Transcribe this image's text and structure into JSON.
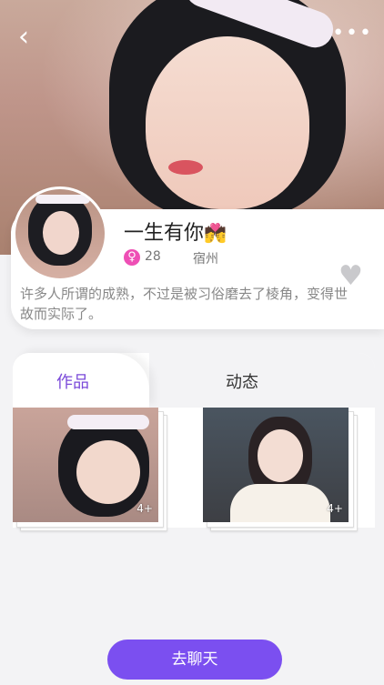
{
  "profile": {
    "name": "一生有你",
    "name_emoji": "💏",
    "gender_symbol": "♀",
    "age": "28",
    "city": "宿州",
    "bio": "许多人所谓的成熟，不过是被习俗磨去了棱角，变得世故而实际了。"
  },
  "header": {
    "back_icon": "‹",
    "more_icon": "•••"
  },
  "tabs": [
    {
      "label": "作品",
      "active": true
    },
    {
      "label": "动态",
      "active": false
    }
  ],
  "works": [
    {
      "count": "4+"
    },
    {
      "count": "4+"
    }
  ],
  "actions": {
    "chat_label": "去聊天",
    "like_icon": "♥"
  },
  "colors": {
    "accent": "#7b4ff0",
    "tab_active": "#7a49d9",
    "gender_badge": "#ee4fb5"
  }
}
